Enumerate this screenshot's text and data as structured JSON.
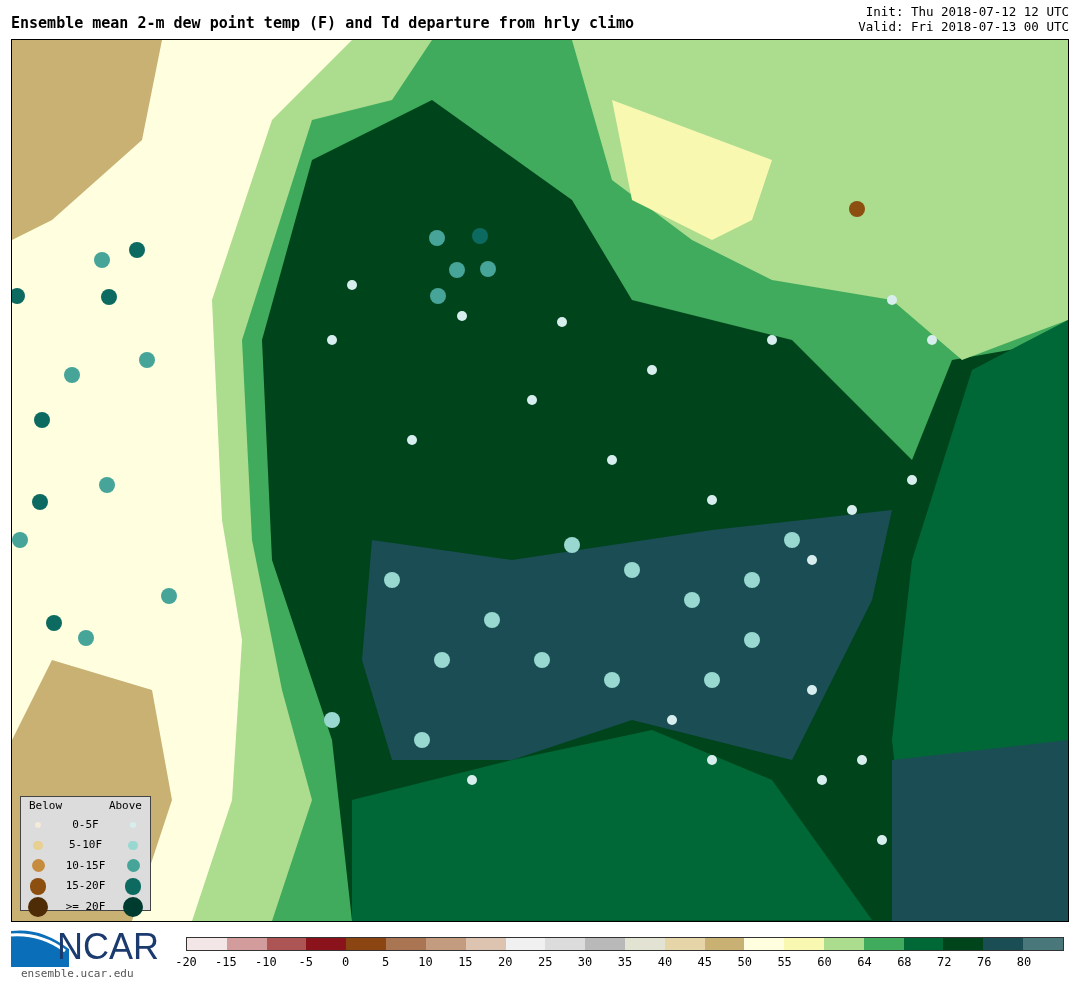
{
  "header": {
    "title": "Ensemble mean 2-m dew point temp (F) and Td departure from hrly climo",
    "init": "Init: Thu 2018-07-12 12 UTC",
    "valid": "Valid: Fri 2018-07-13 00 UTC"
  },
  "legend": {
    "below_label": "Below",
    "above_label": "Above",
    "rows": [
      {
        "label": "0-5F",
        "below": {
          "color": "#f3ead8"
        },
        "above": {
          "color": "#d8eeee"
        }
      },
      {
        "label": "5-10F",
        "below": {
          "color": "#e8cf92"
        },
        "above": {
          "color": "#98d8d0"
        }
      },
      {
        "label": "10-15F",
        "below": {
          "color": "#c68c3e"
        },
        "above": {
          "color": "#46a598"
        }
      },
      {
        "label": "15-20F",
        "below": {
          "color": "#8c4f0f"
        },
        "above": {
          "color": "#0c6a60"
        }
      },
      {
        "label": ">= 20F",
        "below": {
          "color": "#4e2c06"
        },
        "above": {
          "color": "#003b2f"
        }
      }
    ]
  },
  "logo": {
    "text": "NCAR",
    "url": "ensemble.ucar.edu"
  },
  "colorbar": {
    "segments": [
      {
        "color": "#f3e6e6"
      },
      {
        "color": "#d39c9c"
      },
      {
        "color": "#ad5454"
      },
      {
        "color": "#8b141c"
      },
      {
        "color": "#8b4513"
      },
      {
        "color": "#a97552"
      },
      {
        "color": "#c39c80"
      },
      {
        "color": "#dcc4b0"
      },
      {
        "color": "#f0f0f0"
      },
      {
        "color": "#dcdcdc"
      },
      {
        "color": "#b9b9b9"
      },
      {
        "color": "#e3e3d3"
      },
      {
        "color": "#e6d5a8"
      },
      {
        "color": "#c9b173"
      },
      {
        "color": "#ffffe0"
      },
      {
        "color": "#f8f8b0"
      },
      {
        "color": "#acdd8e"
      },
      {
        "color": "#41ab5d"
      },
      {
        "color": "#006837"
      },
      {
        "color": "#00441b"
      },
      {
        "color": "#1b4d55"
      },
      {
        "color": "#4a777a"
      }
    ],
    "ticks": [
      "-20",
      "-15",
      "-10",
      "-5",
      "0",
      "5",
      "10",
      "15",
      "20",
      "25",
      "30",
      "35",
      "40",
      "45",
      "50",
      "55",
      "60",
      "64",
      "68",
      "72",
      "76",
      "80"
    ]
  }
}
